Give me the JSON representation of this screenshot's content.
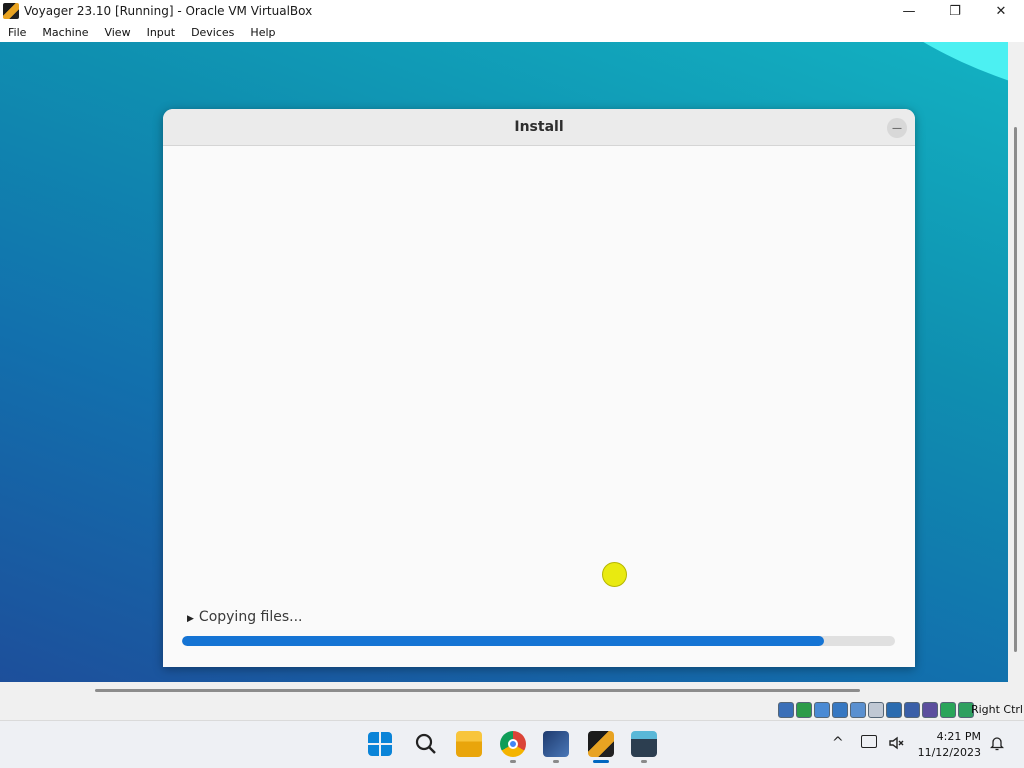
{
  "window": {
    "title": "Voyager 23.10 [Running] - Oracle VM VirtualBox",
    "minimize_glyph": "—",
    "maximize_glyph": "❐",
    "close_glyph": "✕"
  },
  "menubar": {
    "items": [
      "File",
      "Machine",
      "View",
      "Input",
      "Devices",
      "Help"
    ]
  },
  "installer": {
    "title": "Install",
    "minimize_glyph": "—",
    "status_text": "Copying files...",
    "expander_glyph": "▶",
    "progress_fraction": 0.9
  },
  "vbox_status": {
    "host_key": "Right Ctrl",
    "icons": [
      "hard-disk-icon",
      "optical-drive-icon",
      "audio-icon",
      "network-icon",
      "usb-icon",
      "shared-folders-icon",
      "display-icon",
      "recording-icon",
      "virtualization-icon",
      "mouse-integration-icon",
      "keyboard-icon"
    ]
  },
  "taskbar": {
    "apps": [
      "start-icon",
      "search-icon",
      "file-explorer-icon",
      "chrome-icon",
      "virtualbox-icon",
      "voyager-vm-icon",
      "terminal-icon"
    ],
    "tray_chevron": "^",
    "time": "4:21 PM",
    "date": "11/12/2023",
    "colors": {
      "accent": "#0067c0",
      "progress": "#1574d4",
      "cursor": "#e9ea10"
    }
  }
}
